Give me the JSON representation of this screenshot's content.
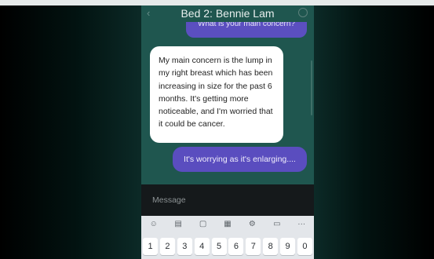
{
  "header": {
    "title": "Bed 2: Bennie Lam",
    "back_icon": "‹"
  },
  "messages": [
    {
      "role": "user",
      "text": "What is your main concern?"
    },
    {
      "role": "patient",
      "text": "My main concern is the lump in my right breast which has been increasing in size for the past 6 months. It's getting more noticeable, and I'm worried that it could be cancer."
    },
    {
      "role": "user",
      "text": "It's worrying as it's enlarging...."
    }
  ],
  "composer": {
    "placeholder": "Message"
  },
  "keyboard": {
    "toolbar": [
      "☺",
      "▤",
      "▢",
      "▦",
      "⚙",
      "▭",
      "···"
    ],
    "number_row": [
      "1",
      "2",
      "3",
      "4",
      "5",
      "6",
      "7",
      "8",
      "9",
      "0"
    ]
  },
  "colors": {
    "chat_background": "#1f564f",
    "user_bubble": "#5a4dbf",
    "patient_bubble": "#ffffff",
    "composer_background": "#15191b",
    "keyboard_background": "#e3e6ea"
  }
}
